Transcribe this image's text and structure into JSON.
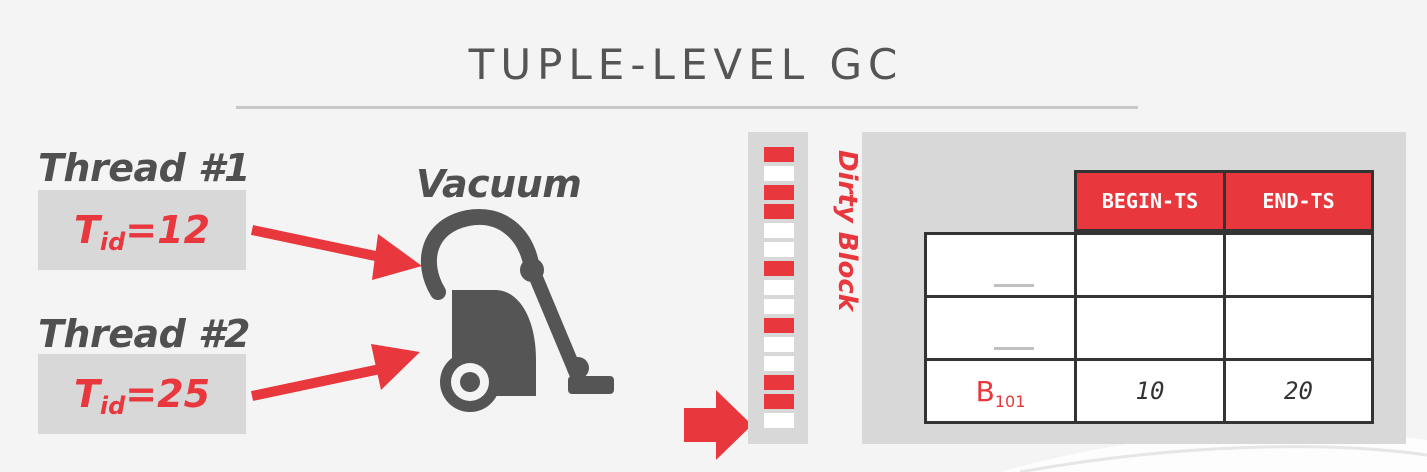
{
  "title": "TUPLE-LEVEL GC",
  "threads": [
    {
      "label": "Thread #1",
      "tid_letter": "T",
      "tid_sub": "id",
      "tid_value": "=12"
    },
    {
      "label": "Thread #2",
      "tid_letter": "T",
      "tid_sub": "id",
      "tid_value": "=25"
    }
  ],
  "vacuum_label": "Vacuum",
  "block": {
    "label": "Dirty Block",
    "slots": [
      "dirty",
      "clean",
      "dirty",
      "dirty",
      "clean",
      "clean",
      "dirty",
      "clean",
      "clean",
      "dirty",
      "clean",
      "clean",
      "dirty",
      "dirty",
      "clean"
    ],
    "pointer_slot": 14
  },
  "table": {
    "headers": [
      "BEGIN-TS",
      "END-TS"
    ],
    "rows": [
      {
        "key": "",
        "key_sub": "",
        "begin_ts": "",
        "end_ts": ""
      },
      {
        "key": "",
        "key_sub": "",
        "begin_ts": "",
        "end_ts": ""
      },
      {
        "key": "B",
        "key_sub": "101",
        "begin_ts": "10",
        "end_ts": "20"
      }
    ]
  },
  "colors": {
    "accent": "#e8373d",
    "icon": "#555555",
    "panel": "#d8d8d8",
    "text": "#505050"
  },
  "icons": [
    "vacuum-cleaner-icon",
    "arrow-right-icon",
    "pointer-arrow-icon"
  ]
}
